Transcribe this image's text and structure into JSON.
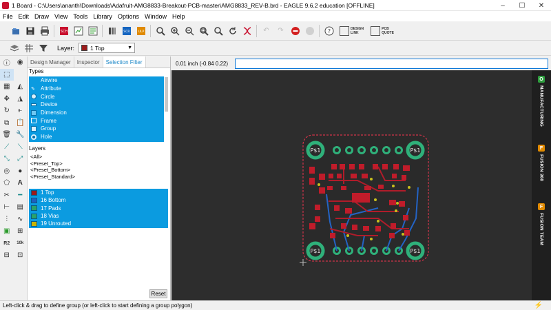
{
  "window": {
    "title": "1 Board - C:\\Users\\ananth\\Downloads\\Adafruit-AMG8833-Breakout-PCB-master\\AMG8833_REV-B.brd - EAGLE 9.6.2 education [OFFLINE]",
    "controls": [
      "–",
      "☐",
      "✕"
    ]
  },
  "menu": [
    "File",
    "Edit",
    "Draw",
    "View",
    "Tools",
    "Library",
    "Options",
    "Window",
    "Help"
  ],
  "toolbar": {
    "design_link": [
      "DESIGN",
      "LINK"
    ],
    "pcb_quote": [
      "PCB",
      "QUOTE"
    ],
    "sch_label": "SCH",
    "ulp_label": "ULP",
    "scr_label": "SCR"
  },
  "layer_bar": {
    "label": "Layer:",
    "selected_layer": "1 Top",
    "selected_color": "#9b1b1b"
  },
  "panel": {
    "tabs": [
      "Design Manager",
      "Inspector",
      "Selection Filter"
    ],
    "types_title": "Types",
    "types": [
      "Airwire",
      "Attribute",
      "Circle",
      "Device",
      "Dimension",
      "Frame",
      "Group",
      "Hole"
    ],
    "layers_title": "Layers",
    "presets": [
      "<All>",
      "<Preset_Top>",
      "<Preset_Bottom>",
      "<Preset_Standard>"
    ],
    "layers": [
      {
        "label": "1 Top",
        "color": "#9b1b1b"
      },
      {
        "label": "16 Bottom",
        "color": "#1f5fbf"
      },
      {
        "label": "17 Pads",
        "color": "#2aa36b"
      },
      {
        "label": "18 Vias",
        "color": "#2aa36b"
      },
      {
        "label": "19 Unrouted",
        "color": "#c8b400"
      }
    ],
    "reset_label": "Reset"
  },
  "command": {
    "coordinates": "0.01 inch (-0.84 0.22)",
    "input_value": ""
  },
  "board": {
    "corner_labels": [
      "P$1",
      "P$1",
      "P$1",
      "P$1"
    ]
  },
  "right_rail": [
    {
      "label": "MANUFACTURING",
      "badge": "O",
      "badge_color": "#2e9e3e"
    },
    {
      "label": "FUSION 360",
      "badge": "F",
      "badge_color": "#e08a00"
    },
    {
      "label": "FUSION TEAM",
      "badge": "F",
      "badge_color": "#e08a00"
    }
  ],
  "status": {
    "message": "Left-click & drag to define group (or left-click to start defining a group polygon)"
  }
}
